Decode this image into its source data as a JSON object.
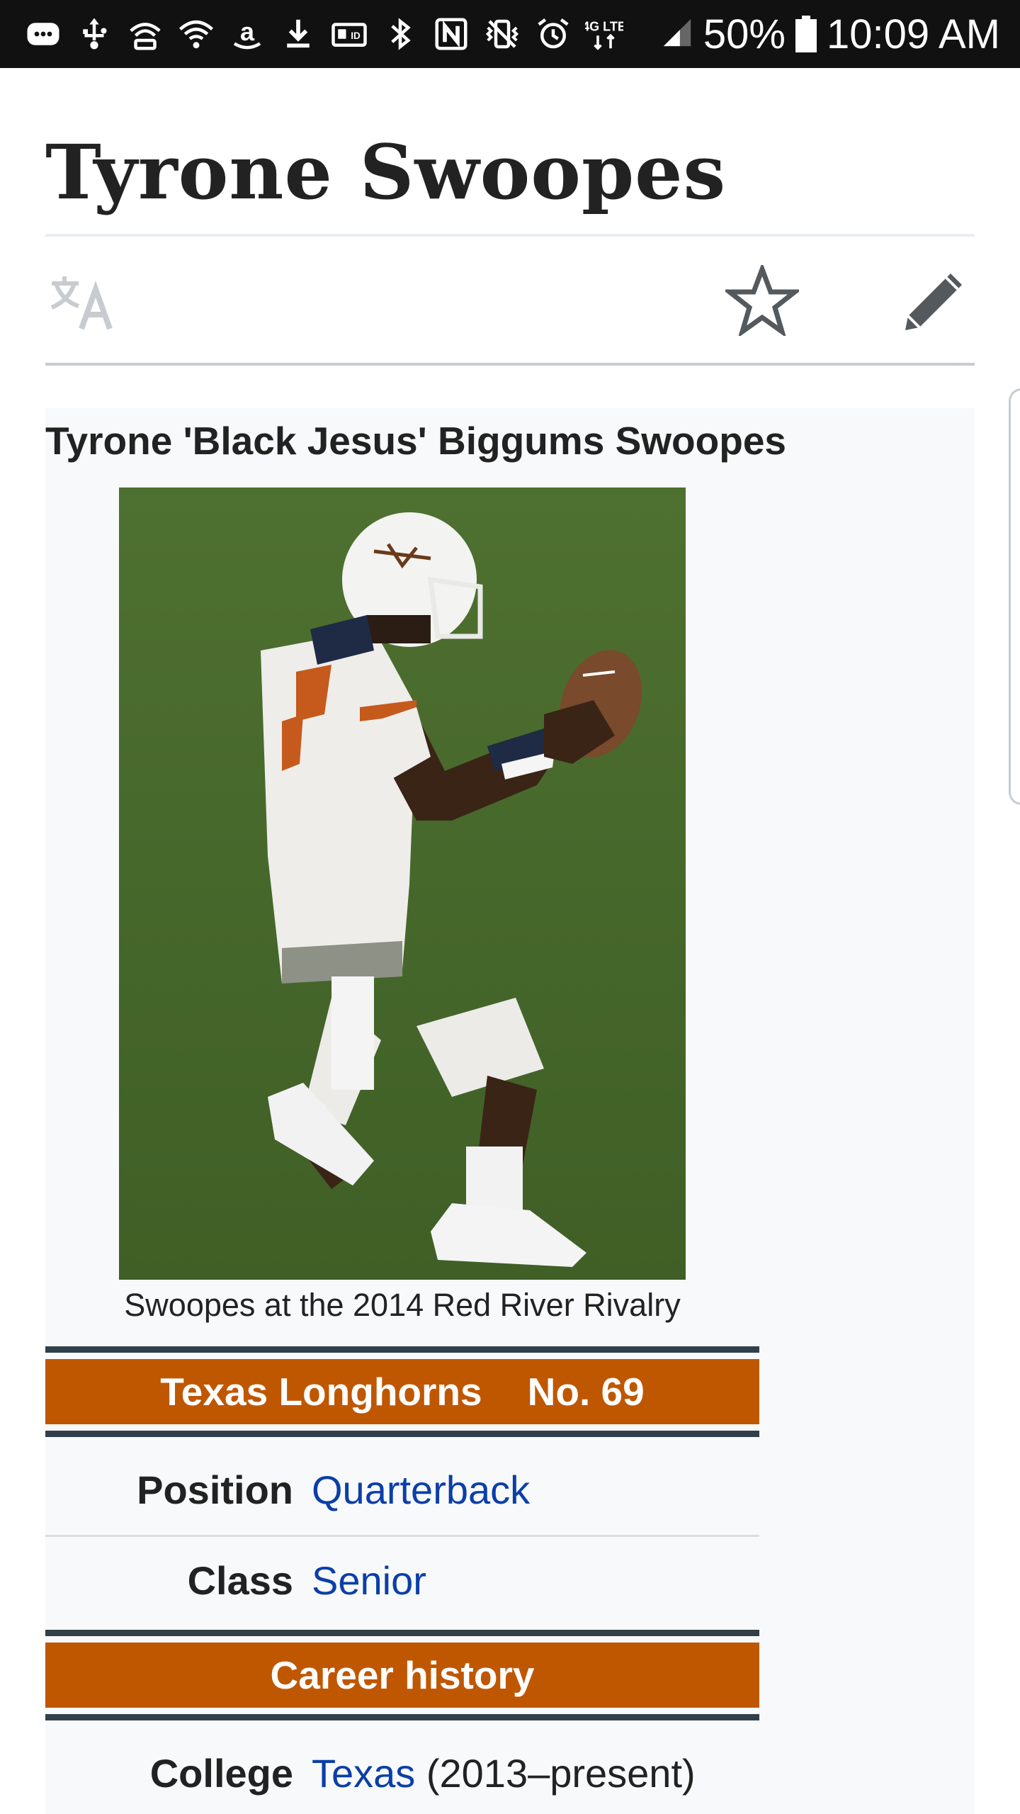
{
  "status_bar": {
    "battery": "50%",
    "time": "10:09 AM",
    "icons": [
      "messages-icon",
      "usb-icon",
      "hotspot-icon",
      "wifi-icon",
      "amazon-icon",
      "download-icon",
      "id-card-icon",
      "bluetooth-icon",
      "nfc-icon",
      "vibrate-icon",
      "alarm-icon",
      "lte-icon",
      "signal-icon",
      "battery-icon"
    ],
    "lte_label": "4G LTE"
  },
  "article": {
    "title": "Tyrone Swoopes"
  },
  "page_actions": {
    "icons": [
      "language-icon",
      "watch-star-icon",
      "edit-pencil-icon"
    ]
  },
  "infobox": {
    "name": "Tyrone 'Black Jesus' Biggums Swoopes",
    "image_caption": "Swoopes at the 2014 Red River Rivalry",
    "team_header": {
      "team": "Texas Longhorns",
      "number": "No. 69"
    },
    "rows": [
      {
        "label": "Position",
        "value": "Quarterback"
      },
      {
        "label": "Class",
        "value": "Senior"
      }
    ],
    "career_header": "Career history",
    "college": {
      "label": "College",
      "link": "Texas",
      "suffix": " (2013–present)"
    },
    "colors": {
      "band": "#bf5700",
      "band_stripe": "#333f48",
      "link": "#0b3fa8",
      "background": "#f8f9fa"
    }
  }
}
